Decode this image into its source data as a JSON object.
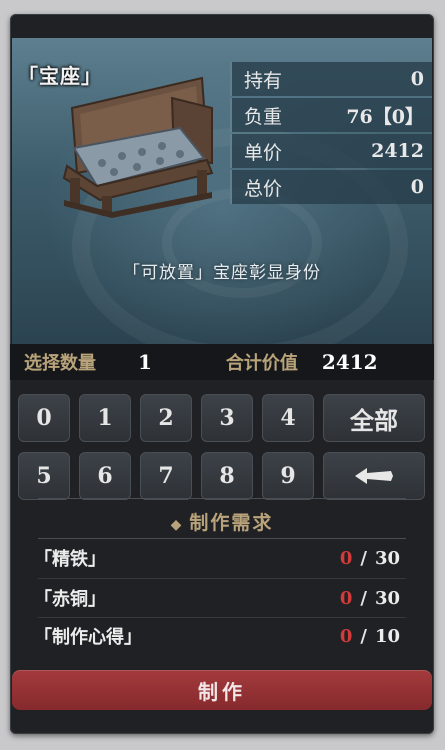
{
  "item": {
    "title": "「宝座」",
    "description": "「可放置」宝座彰显身份"
  },
  "stats": [
    {
      "label": "持有",
      "value": "0"
    },
    {
      "label": "负重",
      "value": "76【0】"
    },
    {
      "label": "单价",
      "value": "2412"
    },
    {
      "label": "总价",
      "value": "0"
    }
  ],
  "quantity": {
    "select_label": "选择数量",
    "select_value": "1",
    "total_label": "合计价值",
    "total_value": "2412"
  },
  "keypad": {
    "row1": [
      "0",
      "1",
      "2",
      "3",
      "4"
    ],
    "row2": [
      "5",
      "6",
      "7",
      "8",
      "9"
    ],
    "all_label": "全部",
    "backspace_icon": "backspace-arrow-icon"
  },
  "requirements": {
    "title": "制作需求",
    "items": [
      {
        "name": "「精铁」",
        "have": "0",
        "need": "30"
      },
      {
        "name": "「赤铜」",
        "have": "0",
        "need": "30"
      },
      {
        "name": "「制作心得」",
        "have": "0",
        "need": "10"
      }
    ]
  },
  "craft_button": "制作",
  "colors": {
    "accent_gold": "#b9a37a",
    "insufficient_red": "#d33a3a",
    "craft_button": "#9a3437"
  }
}
